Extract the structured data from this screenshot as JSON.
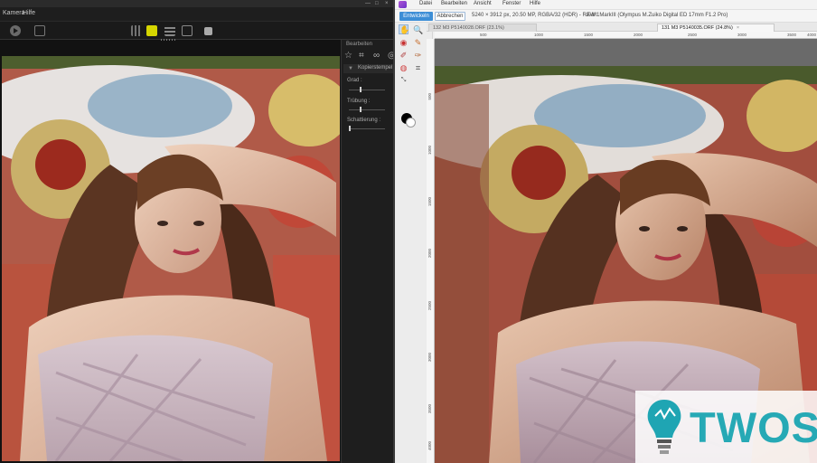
{
  "left_app": {
    "menu": [
      "Kamera",
      "Hilfe"
    ],
    "panel_title": "Bearbeiten",
    "panel_section": "Kopierstempel",
    "sliders": [
      {
        "label": "Grad :",
        "value": 0.3
      },
      {
        "label": "Trübung :",
        "value": 0.3
      },
      {
        "label": "Schattierung :",
        "value": 0.0
      }
    ],
    "tool_icons": [
      "star-icon",
      "crop-icon",
      "binoculars-icon"
    ]
  },
  "right_app": {
    "menu": [
      "Datei",
      "Bearbeiten",
      "Ansicht",
      "Fenster",
      "Hilfe"
    ],
    "develop_button": "Entwickeln",
    "cancel_button": "Abbrechen",
    "image_info": "5240 × 3912 px, 20.50 MP, RGBA/32 (HDR) - RAW",
    "camera_info": "E-M1MarkIII (Olympus M.Zuiko Digital ED 17mm F1.2 Pro)",
    "tabs": [
      {
        "label": "132 M3 P5140028.ORF (23.1%)",
        "active": false
      },
      {
        "label": "131 M3 P5140035.ORF (24.8%)",
        "active": true
      }
    ],
    "ruler_h": [
      "500",
      "1000",
      "1500",
      "2000",
      "2500",
      "3000",
      "3500",
      "4000"
    ],
    "ruler_v": [
      "500",
      "1000",
      "1500",
      "2000",
      "2500",
      "3000",
      "3500",
      "4000"
    ],
    "close_glyph": "×"
  },
  "watermark": {
    "text": "TWOS"
  }
}
